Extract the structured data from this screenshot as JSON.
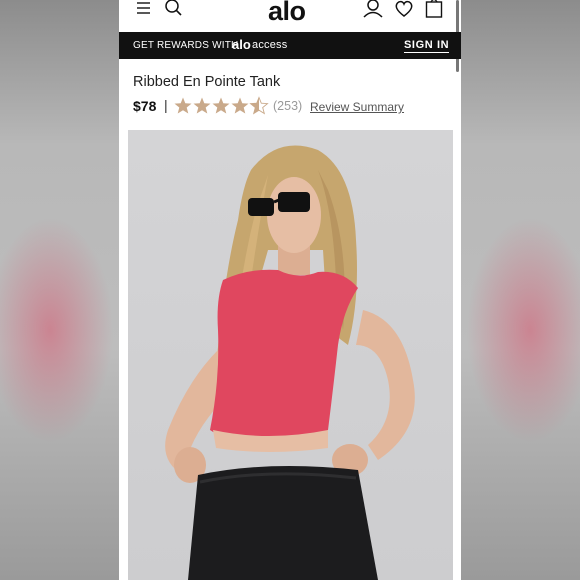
{
  "header": {
    "logo": "alo",
    "icons": [
      "menu-icon",
      "search-icon",
      "account-icon",
      "heart-icon",
      "bag-icon"
    ]
  },
  "banner": {
    "rewards_text": "GET REWARDS WITH",
    "brand_bold": "alo",
    "brand_light": "access",
    "signin": "SIGN IN"
  },
  "product": {
    "title": "Ribbed En Pointe Tank",
    "price": "$78",
    "separator": "|",
    "rating": 4.5,
    "rating_max": 5,
    "review_count": "(253)",
    "review_summary": "Review Summary"
  },
  "colors": {
    "banner_bg": "#111111",
    "star_color": "#c9a98a",
    "tank_color": "#e0475f"
  }
}
